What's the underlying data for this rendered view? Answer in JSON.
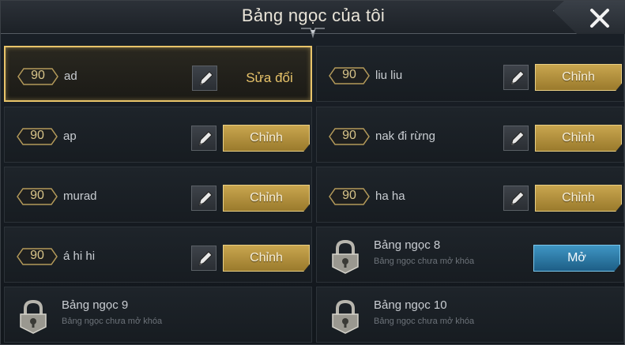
{
  "header": {
    "title": "Bảng ngọc của tôi",
    "close_icon": "close-icon"
  },
  "pages": [
    {
      "level": "90",
      "name": "ad",
      "action_label": "Sửa đổi",
      "selected": true
    },
    {
      "level": "90",
      "name": "liu liu",
      "action_label": "Chỉnh",
      "selected": false
    },
    {
      "level": "90",
      "name": "ap",
      "action_label": "Chỉnh",
      "selected": false
    },
    {
      "level": "90",
      "name": "nak đi rừng",
      "action_label": "Chỉnh",
      "selected": false
    },
    {
      "level": "90",
      "name": "murad",
      "action_label": "Chỉnh",
      "selected": false
    },
    {
      "level": "90",
      "name": "ha ha",
      "action_label": "Chỉnh",
      "selected": false
    },
    {
      "level": "90",
      "name": "á hi hi",
      "action_label": "Chỉnh",
      "selected": false
    }
  ],
  "locked_pages": [
    {
      "title": "Bảng ngọc 8",
      "subtitle": "Bảng ngọc chưa mở khóa",
      "button_label": "Mở"
    },
    {
      "title": "Bảng ngọc 9",
      "subtitle": "Bảng ngọc chưa mở khóa",
      "button_label": ""
    },
    {
      "title": "Bảng ngọc 10",
      "subtitle": "Bảng ngọc chưa mở khóa",
      "button_label": ""
    }
  ],
  "colors": {
    "accent_gold": "#e8c46a",
    "button_gold": "#c9a64f",
    "button_blue": "#3f96c4"
  }
}
